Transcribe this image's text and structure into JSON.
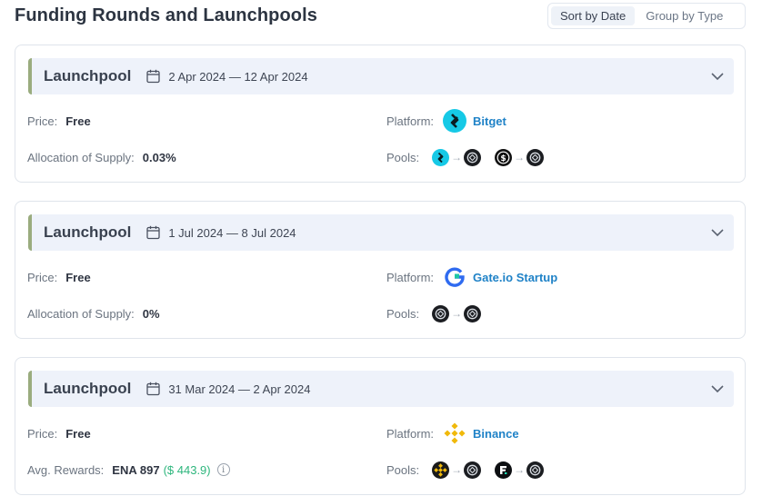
{
  "header": {
    "title": "Funding Rounds and Launchpools",
    "sort_options": [
      "Sort by Date",
      "Group by Type"
    ],
    "active_sort": "Sort by Date"
  },
  "labels": {
    "price": "Price:",
    "allocation": "Allocation of Supply:",
    "avg_rewards": "Avg. Rewards:",
    "platform": "Platform:",
    "pools": "Pools:"
  },
  "cards": [
    {
      "type": "Launchpool",
      "dates": "2 Apr 2024 — 12 Apr 2024",
      "price": "Free",
      "allocation": "0.03%",
      "platform": "Bitget",
      "platform_icon": "bitget-logo-icon",
      "pools": [
        {
          "from": "bitget-token-icon",
          "to": "ethena-icon"
        },
        {
          "from": "usdc-dark-icon",
          "to": "ethena-icon"
        }
      ]
    },
    {
      "type": "Launchpool",
      "dates": "1 Jul 2024 — 8 Jul 2024",
      "price": "Free",
      "allocation": "0%",
      "platform": "Gate.io Startup",
      "platform_icon": "gateio-logo-icon",
      "pools": [
        {
          "from": "ethena-icon",
          "to": "ethena-icon"
        }
      ]
    },
    {
      "type": "Launchpool",
      "dates": "31 Mar 2024 — 2 Apr 2024",
      "price": "Free",
      "avg_rewards": "ENA 897",
      "avg_rewards_usd": "($ 443.9)",
      "platform": "Binance",
      "platform_icon": "binance-logo-icon",
      "pools": [
        {
          "from": "bnb-icon",
          "to": "ethena-icon"
        },
        {
          "from": "fdusd-icon",
          "to": "ethena-icon"
        }
      ]
    }
  ],
  "colors": {
    "accent_bar": "#9aac7e",
    "link": "#1f82c7",
    "usd_green": "#2eb67d",
    "header_bg": "#eef2fa"
  }
}
